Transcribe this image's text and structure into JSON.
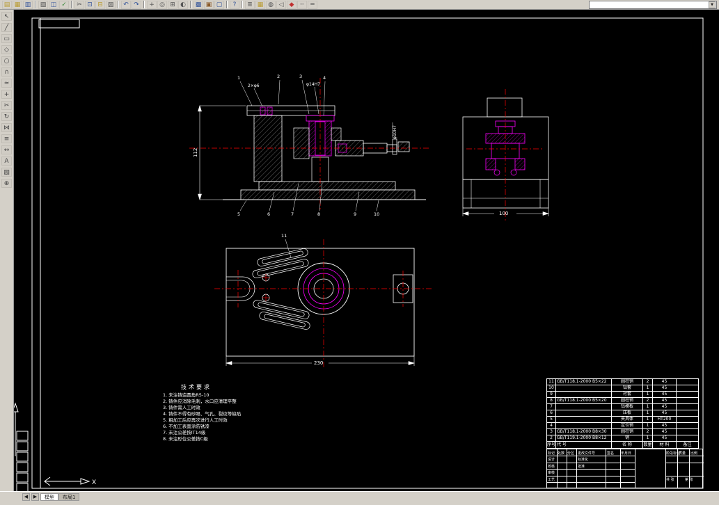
{
  "window": {
    "bg": "#d4d0c8",
    "canvas_bg": "#000000"
  },
  "toolbar_top": {
    "icons": [
      {
        "name": "new-file-icon",
        "glyph": "▤",
        "color": "#b89a30"
      },
      {
        "name": "open-file-icon",
        "glyph": "▦",
        "color": "#b89a30"
      },
      {
        "name": "save-icon",
        "glyph": "▥",
        "color": "#35559a"
      },
      {
        "sep": true
      },
      {
        "name": "plot-icon",
        "glyph": "▧",
        "color": "#555555"
      },
      {
        "name": "print-preview-icon",
        "glyph": "◫",
        "color": "#35559a"
      },
      {
        "name": "spell-check-icon",
        "glyph": "✓",
        "color": "#3a8a3a"
      },
      {
        "sep": true
      },
      {
        "name": "cut-icon",
        "glyph": "✂",
        "color": "#555555"
      },
      {
        "name": "copy-icon",
        "glyph": "⊡",
        "color": "#35559a"
      },
      {
        "name": "paste-icon",
        "glyph": "⊟",
        "color": "#b89a30"
      },
      {
        "name": "match-properties-icon",
        "glyph": "▨",
        "color": "#555555"
      },
      {
        "sep": true
      },
      {
        "name": "undo-icon",
        "glyph": "↶",
        "color": "#35559a"
      },
      {
        "name": "redo-icon",
        "glyph": "↷",
        "color": "#35559a"
      },
      {
        "sep": true
      },
      {
        "name": "pan-icon",
        "glyph": "+",
        "color": "#555555"
      },
      {
        "name": "zoom-realtime-icon",
        "glyph": "◎",
        "color": "#555555"
      },
      {
        "name": "zoom-window-icon",
        "glyph": "⊞",
        "color": "#555555"
      },
      {
        "name": "zoom-previous-icon",
        "glyph": "◐",
        "color": "#555555"
      },
      {
        "sep": true
      },
      {
        "name": "properties-icon",
        "glyph": "▩",
        "color": "#35559a"
      },
      {
        "name": "design-center-icon",
        "glyph": "▣",
        "color": "#8a5a2a"
      },
      {
        "name": "tool-palettes-icon",
        "glyph": "▢",
        "color": "#35559a"
      },
      {
        "sep": true
      },
      {
        "name": "help-icon",
        "glyph": "?",
        "color": "#35559a"
      },
      {
        "sep": true
      },
      {
        "name": "layers-icon",
        "glyph": "≣",
        "color": "#555555"
      },
      {
        "name": "layer-states-icon",
        "glyph": "▦",
        "color": "#b89a30"
      },
      {
        "name": "make-object-layer-icon",
        "glyph": "◍",
        "color": "#555555"
      },
      {
        "name": "layer-previous-icon",
        "glyph": "◁",
        "color": "#555555"
      },
      {
        "name": "color-control-icon",
        "glyph": "◆",
        "color": "#c03030"
      },
      {
        "name": "linetype-control-icon",
        "glyph": "┄",
        "color": "#555555"
      },
      {
        "name": "lineweight-control-icon",
        "glyph": "━",
        "color": "#555555"
      }
    ],
    "combo": {
      "value": ""
    },
    "dropdown_glyph": "▼"
  },
  "toolbar_left": {
    "icons": [
      {
        "name": "select-icon",
        "glyph": "↖"
      },
      {
        "name": "line-icon",
        "glyph": "╱"
      },
      {
        "name": "rectangle-icon",
        "glyph": "▭"
      },
      {
        "name": "polygon-icon",
        "glyph": "◇"
      },
      {
        "name": "circle-icon",
        "glyph": "○"
      },
      {
        "name": "arc-icon",
        "glyph": "∩"
      },
      {
        "name": "spline-icon",
        "glyph": "≈"
      },
      {
        "name": "move-icon",
        "glyph": "+"
      },
      {
        "name": "trim-icon",
        "glyph": "✂"
      },
      {
        "name": "rotate-icon",
        "glyph": "↻"
      },
      {
        "name": "mirror-icon",
        "glyph": "⋈"
      },
      {
        "name": "offset-icon",
        "glyph": "≡"
      },
      {
        "name": "dimension-icon",
        "glyph": "↔"
      },
      {
        "name": "text-icon",
        "glyph": "A"
      },
      {
        "name": "hatch-icon",
        "glyph": "▨"
      },
      {
        "name": "insert-block-icon",
        "glyph": "⊕"
      }
    ]
  },
  "status_bar": {
    "nav_prev": "◀",
    "nav_next": "▶",
    "tabs": [
      {
        "label": "模型",
        "active": true
      },
      {
        "label": "布局1",
        "active": false
      }
    ]
  },
  "drawing": {
    "colors": {
      "line": "#ffffff",
      "highlight": "#ff00ff",
      "centerline": "#ff0000"
    },
    "dims": {
      "front_height": "112",
      "side_width": "100",
      "plan_width": "230",
      "front_hole": "2×φ6",
      "front_bush": "φ14H7",
      "front_shaft": "φ10H7"
    },
    "balloons": [
      "1",
      "2",
      "3",
      "4",
      "5",
      "6",
      "7",
      "8",
      "9",
      "10",
      "11"
    ],
    "ucs_x": "X",
    "tech_req": {
      "title": "技术要求",
      "items": [
        "1. 未注铸造圆角R5-10",
        "2. 铸件应消除毛刺，水口应清理平整",
        "3. 铸件需人工时效",
        "4. 铸件不得有砂眼、气孔、裂纹等缺陷",
        "5. 粗加工后应再次进行人工时效",
        "6. 不加工表面涂防锈漆",
        "7. 未注公差按IT14级",
        "8. 未注形位公差按C级"
      ]
    },
    "parts_list": {
      "headers": [
        "序号",
        "代 号",
        "名 称",
        "数量",
        "材 料",
        "备注"
      ],
      "rows": [
        {
          "no": "11",
          "code": "GB/T118.1-2000 B5×22",
          "name": "圆柱销",
          "qty": "2",
          "mat": "45",
          "note": ""
        },
        {
          "no": "10",
          "code": "",
          "name": "钻套",
          "qty": "1",
          "mat": "45",
          "note": ""
        },
        {
          "no": "9",
          "code": "",
          "name": "衬套",
          "qty": "1",
          "mat": "45",
          "note": ""
        },
        {
          "no": "8",
          "code": "GB/T118.1-2000 B5×20",
          "name": "圆柱销",
          "qty": "2",
          "mat": "45",
          "note": ""
        },
        {
          "no": "7",
          "code": "",
          "name": "钻模板",
          "qty": "1",
          "mat": "45",
          "note": ""
        },
        {
          "no": "6",
          "code": "",
          "name": "压板",
          "qty": "1",
          "mat": "45",
          "note": ""
        },
        {
          "no": "5",
          "code": "",
          "name": "夹具体",
          "qty": "1",
          "mat": "HT200",
          "note": ""
        },
        {
          "no": "4",
          "code": "",
          "name": "定位销",
          "qty": "1",
          "mat": "45",
          "note": ""
        },
        {
          "no": "3",
          "code": "GB/T118.1-2000 B8×30",
          "name": "圆柱销",
          "qty": "2",
          "mat": "45",
          "note": ""
        },
        {
          "no": "2",
          "code": "GB/T119.1-2000 B8×12",
          "name": "销",
          "qty": "1",
          "mat": "45",
          "note": ""
        }
      ]
    },
    "title_block": {
      "mark": "标记",
      "count": "处数",
      "zone": "分区",
      "change_doc": "更改文件号",
      "sign": "签名",
      "date": "年月日",
      "design": "设计",
      "check": "校核",
      "review": "审核",
      "craft": "工艺",
      "standard": "标准化",
      "approve": "批准",
      "stage": "阶段标记",
      "weight": "质量",
      "scale": "比例",
      "sheets": "共 张",
      "sheet": "第 张"
    }
  }
}
